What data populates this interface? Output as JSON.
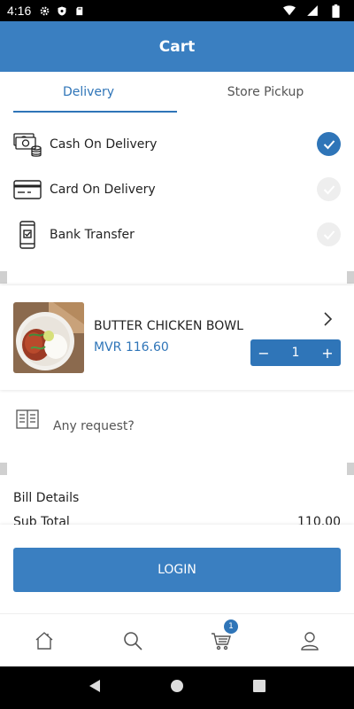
{
  "status_bar": {
    "time": "4:16"
  },
  "header": {
    "title": "Cart"
  },
  "tabs": [
    {
      "label": "Delivery",
      "active": true
    },
    {
      "label": "Store Pickup",
      "active": false
    }
  ],
  "payment_options": [
    {
      "label": "Cash On Delivery",
      "icon": "cash-icon",
      "selected": true
    },
    {
      "label": "Card On Delivery",
      "icon": "card-icon",
      "selected": false
    },
    {
      "label": "Bank Transfer",
      "icon": "phone-bank-icon",
      "selected": false
    }
  ],
  "cart_item": {
    "name": "BUTTER CHICKEN BOWL",
    "price": "MVR 116.60",
    "quantity": "1",
    "minus": "−",
    "plus": "+"
  },
  "request": {
    "placeholder": "Any request?"
  },
  "bill": {
    "title": "Bill Details",
    "subtotal_label": "Sub Total",
    "subtotal_value": "110.00"
  },
  "login": {
    "label": "LOGIN"
  },
  "bottom_nav": {
    "cart_badge": "1"
  },
  "colors": {
    "accent": "#3a7fc1",
    "accent_text": "#2f75b8"
  }
}
